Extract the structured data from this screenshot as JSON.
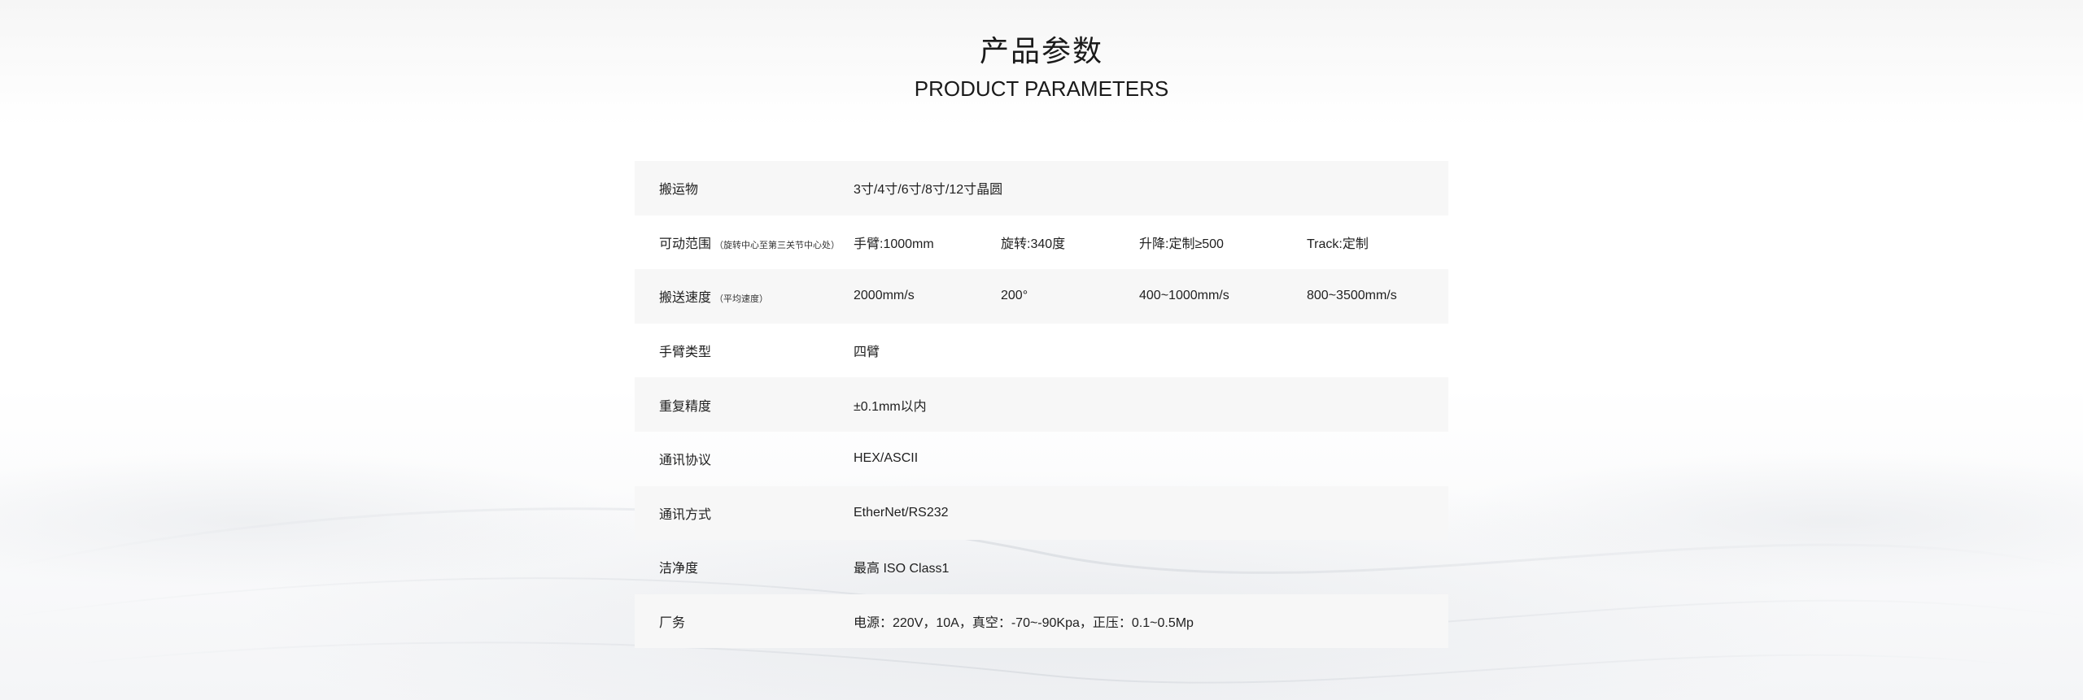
{
  "header": {
    "title_cn": "产品参数",
    "title_en": "PRODUCT PARAMETERS"
  },
  "specs": [
    {
      "label": "搬运物",
      "value": "3寸/4寸/6寸/8寸/12寸晶圆"
    },
    {
      "label": "可动范围",
      "note": "（旋转中心至第三关节中心处）",
      "values": [
        "手臂:1000mm",
        "旋转:340度",
        "升降:定制≥500",
        "Track:定制"
      ]
    },
    {
      "label": "搬送速度",
      "note": "（平均速度）",
      "values": [
        "2000mm/s",
        "200°",
        "400~1000mm/s",
        "800~3500mm/s"
      ]
    },
    {
      "label": "手臂类型",
      "value": "四臂"
    },
    {
      "label": "重复精度",
      "value": "±0.1mm以内"
    },
    {
      "label": "通讯协议",
      "value": "HEX/ASCII"
    },
    {
      "label": "通讯方式",
      "value": "EtherNet/RS232"
    },
    {
      "label": "洁净度",
      "value": "最高 ISO Class1"
    },
    {
      "label": "厂务",
      "value": "电源：220V，10A，真空：-70~-90Kpa，正压：0.1~0.5Mp"
    }
  ]
}
